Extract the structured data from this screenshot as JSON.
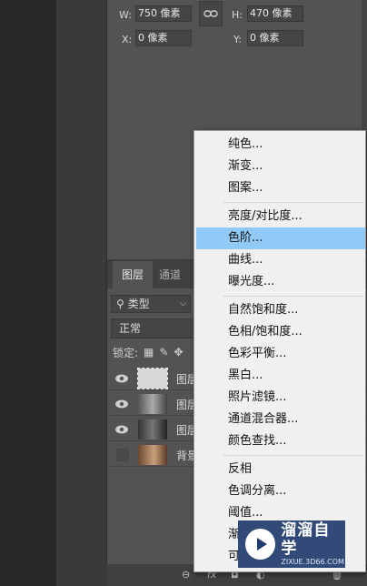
{
  "properties": {
    "w_label": "W:",
    "w_value": "750 像素",
    "h_label": "H:",
    "h_value": "470 像素",
    "x_label": "X:",
    "x_value": "0 像素",
    "y_label": "Y:",
    "y_value": "0 像素"
  },
  "layers_panel": {
    "tabs": [
      "图层",
      "通道"
    ],
    "filter_label": "类型",
    "blend_mode": "正常",
    "lock_label": "锁定:",
    "layers": [
      {
        "name": "图层",
        "visible": true
      },
      {
        "name": "图层",
        "visible": true
      },
      {
        "name": "图层",
        "visible": true
      },
      {
        "name": "背景",
        "visible": false
      }
    ]
  },
  "bottom_bar": {
    "fx_label": "fx"
  },
  "adjustment_menu": {
    "groups": [
      [
        "纯色...",
        "渐变...",
        "图案..."
      ],
      [
        "亮度/对比度...",
        "色阶...",
        "曲线...",
        "曝光度..."
      ],
      [
        "自然饱和度...",
        "色相/饱和度...",
        "色彩平衡...",
        "黑白...",
        "照片滤镜...",
        "通道混合器...",
        "颜色查找..."
      ],
      [
        "反相",
        "色调分离...",
        "阈值...",
        "渐",
        "可"
      ]
    ],
    "highlighted": "色阶..."
  },
  "watermark": {
    "title": "溜溜自学",
    "subtitle": "ZIXUE.3D66.COM"
  }
}
